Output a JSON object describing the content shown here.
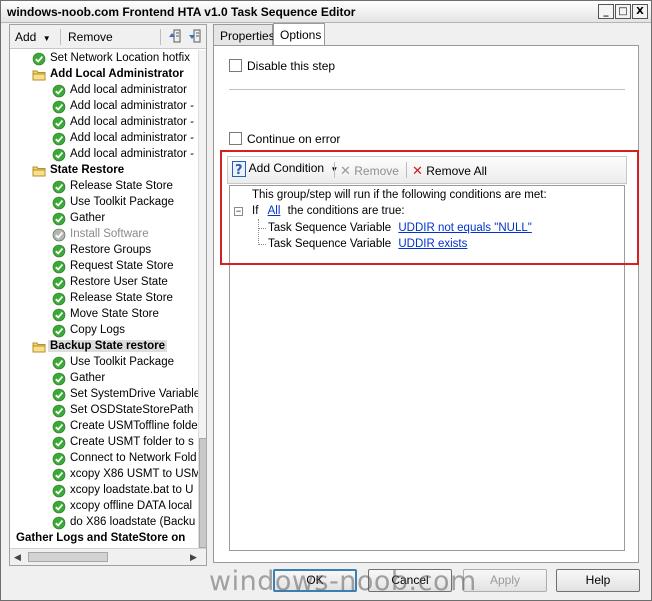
{
  "window": {
    "title": "windows-noob.com Frontend HTA v1.0 Task Sequence Editor",
    "minimize": "_",
    "maximize": "□",
    "close": "X"
  },
  "left_toolbar": {
    "add_label": "Add",
    "remove_label": "Remove"
  },
  "tree": {
    "items": [
      {
        "label": "Set Network Location hotfix",
        "type": "step"
      },
      {
        "label": "Add Local Administrator",
        "type": "group"
      },
      {
        "label": "Add local administrator",
        "type": "step"
      },
      {
        "label": "Add local administrator -",
        "type": "step"
      },
      {
        "label": "Add local administrator -",
        "type": "step"
      },
      {
        "label": "Add local administrator -",
        "type": "step"
      },
      {
        "label": "Add local administrator -",
        "type": "step"
      },
      {
        "label": "State Restore",
        "type": "group"
      },
      {
        "label": "Release State Store",
        "type": "step"
      },
      {
        "label": "Use Toolkit Package",
        "type": "step"
      },
      {
        "label": "Gather",
        "type": "step"
      },
      {
        "label": "Install Software",
        "type": "disabled"
      },
      {
        "label": "Restore Groups",
        "type": "step"
      },
      {
        "label": "Request State Store",
        "type": "step"
      },
      {
        "label": "Restore User State",
        "type": "step"
      },
      {
        "label": "Release State Store",
        "type": "step"
      },
      {
        "label": "Move State Store",
        "type": "step"
      },
      {
        "label": "Copy Logs",
        "type": "step"
      },
      {
        "label": "Backup State restore",
        "type": "group-selected"
      },
      {
        "label": "Use Toolkit Package",
        "type": "step"
      },
      {
        "label": "Gather",
        "type": "step"
      },
      {
        "label": "Set SystemDrive Variable",
        "type": "step"
      },
      {
        "label": "Set OSDStateStorePath",
        "type": "step"
      },
      {
        "label": "Create USMToffline folde",
        "type": "step"
      },
      {
        "label": "Create USMT folder to s",
        "type": "step"
      },
      {
        "label": "Connect to Network Fold",
        "type": "step"
      },
      {
        "label": "xcopy X86 USMT to USM",
        "type": "step"
      },
      {
        "label": "xcopy loadstate.bat to U",
        "type": "step"
      },
      {
        "label": "xcopy offline DATA local",
        "type": "step"
      },
      {
        "label": "do X86 loadstate (Backu",
        "type": "step"
      },
      {
        "label": "Gather Logs and StateStore on",
        "type": "root-group"
      }
    ]
  },
  "tabs": [
    {
      "label": "Properties",
      "active": false
    },
    {
      "label": "Options",
      "active": true
    }
  ],
  "options": {
    "disable_step_label": "Disable this step",
    "continue_on_error_label": "Continue on error"
  },
  "conditions_toolbar": {
    "add_condition_label": "Add Condition",
    "remove_label": "Remove",
    "remove_all_label": "Remove All"
  },
  "conditions": {
    "intro": "This group/step will run if the following conditions are met:",
    "if_word": "If",
    "all_link": "All",
    "are_true": "the conditions are true:",
    "rows": [
      {
        "prefix": "Task Sequence Variable",
        "link": "UDDIR not equals \"NULL\""
      },
      {
        "prefix": "Task Sequence Variable",
        "link": "UDDIR exists"
      }
    ],
    "expander": "−"
  },
  "buttons": {
    "ok": "OK",
    "cancel": "Cancel",
    "apply": "Apply",
    "help": "Help"
  },
  "watermark": "windows-noob.com",
  "colors": {
    "highlight_border": "#d42020",
    "link": "#0033cc",
    "step_ok_green": "#3aa935"
  }
}
